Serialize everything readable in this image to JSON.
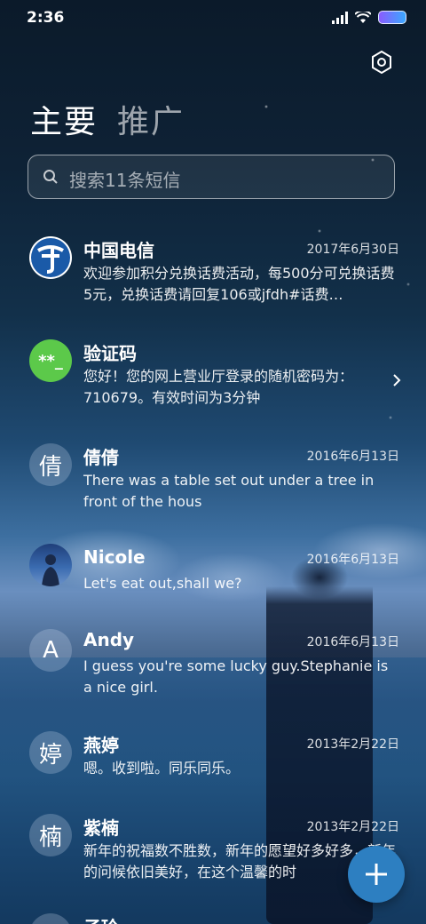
{
  "status_bar": {
    "time": "2:36"
  },
  "tabs": {
    "primary": "主要",
    "promo": "推广"
  },
  "search": {
    "placeholder": "搜索11条短信"
  },
  "messages": [
    {
      "name": "中国电信",
      "date": "2017年6月30日",
      "preview": "欢迎参加积分兑换话费活动，每500分可兑换话费5元，兑换话费请回复106或jfdh#话费…",
      "avatar": "telecom-logo"
    },
    {
      "name": "验证码",
      "date": "",
      "preview": "您好！您的网上营业厅登录的随机密码为：710679。有效时间为3分钟",
      "avatar_text": "**_"
    },
    {
      "name": "倩倩",
      "date": "2016年6月13日",
      "preview": "There was a table set out under a tree in front of the hous",
      "avatar_text": "倩"
    },
    {
      "name": "Nicole",
      "date": "2016年6月13日",
      "preview": "Let's eat out,shall we?",
      "avatar": "photo"
    },
    {
      "name": "Andy",
      "date": "2016年6月13日",
      "preview": "I guess you're some lucky guy.Stephanie is a nice girl.",
      "avatar_text": "A"
    },
    {
      "name": "燕婷",
      "date": "2013年2月22日",
      "preview": "嗯。收到啦。同乐同乐。",
      "avatar_text": "婷"
    },
    {
      "name": "紫楠",
      "date": "2013年2月22日",
      "preview": "新年的祝福数不胜数，新年的愿望好多好多，新年的问候依旧美好，在这个温馨的时",
      "avatar_text": "楠"
    },
    {
      "name": "子玲",
      "date": "",
      "preview": "",
      "avatar_text": ""
    }
  ],
  "colors": {
    "accent": "#2d7fc1",
    "verify_avatar": "#5cc94a",
    "telecom_blue": "#1a5aa8"
  }
}
